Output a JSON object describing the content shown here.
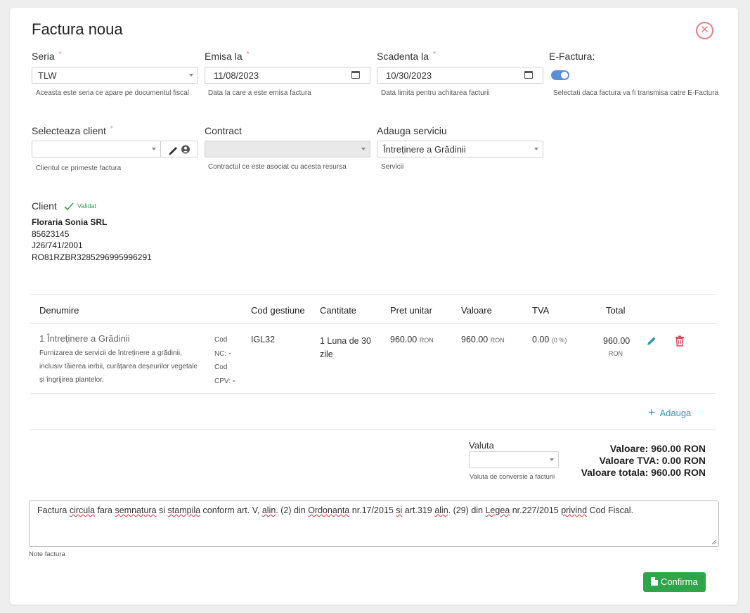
{
  "header": {
    "title": "Factura noua"
  },
  "fields": {
    "seria": {
      "label": "Seria",
      "value": "TLW",
      "help": "Aceasta este seria ce apare pe documentul fiscal"
    },
    "emisa": {
      "label": "Emisa la",
      "value": "11/08/2023",
      "help": "Data la care a este emisa factura"
    },
    "scadenta": {
      "label": "Scadenta la",
      "value": "10/30/2023",
      "help": "Data limita pentru achitarea facturii"
    },
    "efactura": {
      "label": "E-Factura:",
      "help": "Selectati daca factura va fi transmisa catre E-Factura",
      "enabled": true
    },
    "client_select": {
      "label": "Selecteaza client",
      "value": "",
      "help": "Clientul ce primeste factura"
    },
    "contract": {
      "label": "Contract",
      "value": "",
      "help": "Contractul ce este asociat cu acesta resursa"
    },
    "serviciu": {
      "label": "Adauga serviciu",
      "value": "Întreținere a Grădinii",
      "help": "Servicii"
    }
  },
  "client": {
    "label": "Client",
    "status": "Validat",
    "name": "Floraria Sonia SRL",
    "cui": "85623145",
    "reg": "J26/741/2001",
    "iban": "RO81RZBR3285296995996291"
  },
  "table": {
    "headers": [
      "Denumire",
      "Cod gestiune",
      "Cantitate",
      "Pret unitar",
      "Valoare",
      "TVA",
      "Total"
    ],
    "row": {
      "name": "1 Întreținere a Grădinii",
      "description_lines": [
        "Furnizarea de servicii de întreținere a grădinii,",
        "inclusiv tăierea ierbii, curățarea deșeurilor vegetale",
        "și îngrijirea plantelor."
      ],
      "cod_nc_label_1": "Cod",
      "cod_nc_label_2": "NC:",
      "cod_nc_value": "-",
      "cod_cpv_label_1": "Cod",
      "cod_cpv_label_2": "CPV:",
      "cod_cpv_value": "-",
      "cod_gestiune": "IGL32",
      "cantitate_line1": "1 Luna de 30",
      "cantitate_line2": "zile",
      "pret_unitar": "960.00",
      "pret_currency": "RON",
      "valoare": "960.00",
      "valoare_currency": "RON",
      "tva": "0.00",
      "tva_pct": "(0 %)",
      "total": "960.00",
      "total_currency": "RON"
    },
    "add_label": "Adauga"
  },
  "valuta": {
    "label": "Valuta",
    "value": "",
    "help": "Valuta de conversie a facturii"
  },
  "totals": {
    "valoare": "Valoare: 960.00 RON",
    "valoare_tva": "Valoare TVA: 0.00 RON",
    "valoare_totala": "Valoare totala: 960.00 RON"
  },
  "notes": {
    "seg1": "Factura ",
    "seg2": "circula",
    "seg3": " fara ",
    "seg4": "semnatura",
    "seg5": " si ",
    "seg6": "stampila",
    "seg7": " conform art. V, ",
    "seg8": "alin",
    "seg9": ". (2) din ",
    "seg10": "Ordonanta",
    "seg11": " nr.17/2015 ",
    "seg12": "si",
    "seg13": " art.319 ",
    "seg14": "alin",
    "seg15": ". (29) din ",
    "seg16": "Legea",
    "seg17": " nr.227/2015 ",
    "seg18": "privind",
    "seg19": " Cod Fiscal.",
    "help": "Note factura"
  },
  "actions": {
    "confirm_label": "Confirma"
  },
  "colors": {
    "accent": "#2ea548",
    "toggle": "#5b8ed9",
    "danger": "#e57f8c",
    "link": "#2a9bb0"
  }
}
